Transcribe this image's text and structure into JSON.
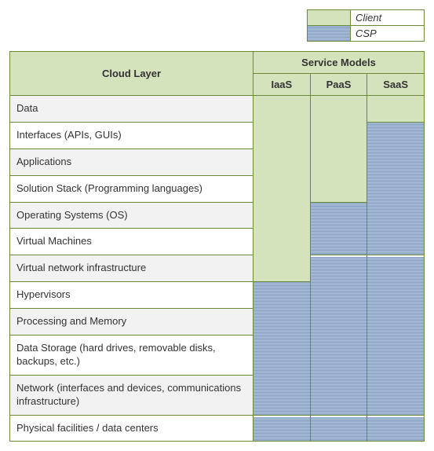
{
  "legend": {
    "client": "Client",
    "csp": "CSP"
  },
  "headers": {
    "cloud_layer": "Cloud Layer",
    "service_models": "Service Models",
    "iaas": "IaaS",
    "paas": "PaaS",
    "saas": "SaaS"
  },
  "layers": [
    {
      "name": "Data"
    },
    {
      "name": "Interfaces (APIs, GUIs)"
    },
    {
      "name": "Applications"
    },
    {
      "name": "Solution Stack (Programming languages)"
    },
    {
      "name": "Operating Systems (OS)"
    },
    {
      "name": "Virtual Machines"
    },
    {
      "name": "Virtual network infrastructure"
    },
    {
      "name": "Hypervisors"
    },
    {
      "name": "Processing and Memory"
    },
    {
      "name": "Data Storage (hard drives, removable disks, backups, etc.)"
    },
    {
      "name": "Network (interfaces and devices, communications infrastructure)"
    },
    {
      "name": "Physical facilities / data centers"
    }
  ],
  "chart_data": {
    "type": "table",
    "title": "Cloud Layer vs Service Model Responsibility",
    "legend": {
      "client": "Client",
      "csp": "CSP"
    },
    "columns": [
      "IaaS",
      "PaaS",
      "SaaS"
    ],
    "rows": [
      {
        "layer": "Data",
        "IaaS": "Client",
        "PaaS": "Client",
        "SaaS": "Client"
      },
      {
        "layer": "Interfaces (APIs, GUIs)",
        "IaaS": "Client",
        "PaaS": "Client",
        "SaaS": "CSP"
      },
      {
        "layer": "Applications",
        "IaaS": "Client",
        "PaaS": "Client",
        "SaaS": "CSP"
      },
      {
        "layer": "Solution Stack (Programming languages)",
        "IaaS": "Client",
        "PaaS": "Client",
        "SaaS": "CSP"
      },
      {
        "layer": "Operating Systems (OS)",
        "IaaS": "Client",
        "PaaS": "CSP",
        "SaaS": "CSP"
      },
      {
        "layer": "Virtual Machines",
        "IaaS": "Client",
        "PaaS": "CSP",
        "SaaS": "CSP"
      },
      {
        "layer": "Virtual network infrastructure",
        "IaaS": "Client",
        "PaaS": "CSP",
        "SaaS": "CSP"
      },
      {
        "layer": "Hypervisors",
        "IaaS": "CSP",
        "PaaS": "CSP",
        "SaaS": "CSP"
      },
      {
        "layer": "Processing and Memory",
        "IaaS": "CSP",
        "PaaS": "CSP",
        "SaaS": "CSP"
      },
      {
        "layer": "Data Storage (hard drives, removable disks, backups, etc.)",
        "IaaS": "CSP",
        "PaaS": "CSP",
        "SaaS": "CSP"
      },
      {
        "layer": "Network (interfaces and devices, communications infrastructure)",
        "IaaS": "CSP",
        "PaaS": "CSP",
        "SaaS": "CSP"
      },
      {
        "layer": "Physical facilities / data centers",
        "IaaS": "CSP",
        "PaaS": "CSP",
        "SaaS": "CSP"
      }
    ]
  }
}
